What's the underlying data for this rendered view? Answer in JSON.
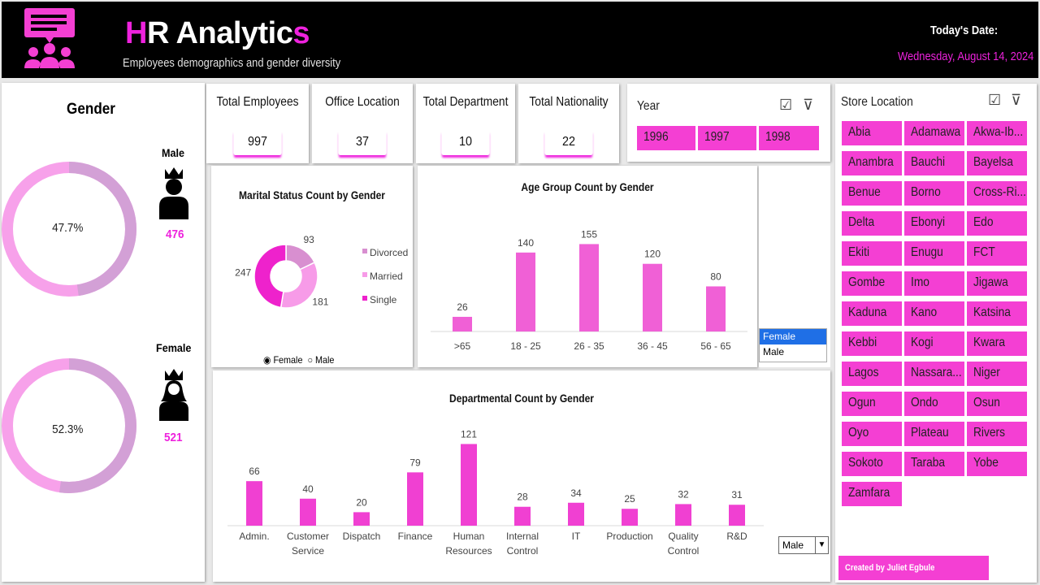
{
  "header": {
    "title_first": "H",
    "title_middle": "R Analytic",
    "title_last": "s",
    "subtitle": "Employees demographics and gender diversity",
    "date_label": "Today's Date:",
    "date_value": "Wednesday, August 14, 2024",
    "logo_icon": "presentation-team-icon"
  },
  "gender": {
    "title": "Gender",
    "male_label": "Male",
    "male_count": "476",
    "male_pct": "47.7%",
    "male_fraction": 0.477,
    "female_label": "Female",
    "female_count": "521",
    "female_pct": "52.3%",
    "female_fraction": 0.523
  },
  "kpis": [
    {
      "title": "Total Employees",
      "value": "997"
    },
    {
      "title": "Office Location",
      "value": "37"
    },
    {
      "title": "Total Department",
      "value": "10"
    },
    {
      "title": "Total Nationality",
      "value": "22"
    }
  ],
  "year_slicer": {
    "title": "Year",
    "items": [
      "1996",
      "1997",
      "1998"
    ]
  },
  "store_slicer": {
    "title": "Store Location",
    "items": [
      "Abia",
      "Adamawa",
      "Akwa-Ib...",
      "Anambra",
      "Bauchi",
      "Bayelsa",
      "Benue",
      "Borno",
      "Cross-Ri...",
      "Delta",
      "Ebonyi",
      "Edo",
      "Ekiti",
      "Enugu",
      "FCT",
      "Gombe",
      "Imo",
      "Jigawa",
      "Kaduna",
      "Kano",
      "Katsina",
      "Kebbi",
      "Kogi",
      "Kwara",
      "Lagos",
      "Nassara...",
      "Niger",
      "Ogun",
      "Ondo",
      "Osun",
      "Oyo",
      "Plateau",
      "Rivers",
      "Sokoto",
      "Taraba",
      "Yobe",
      "Zamfara"
    ]
  },
  "marital": {
    "radio_female": "Female",
    "radio_male": "Male",
    "selected": "Female"
  },
  "gender_select": {
    "options": [
      "Female",
      "Male"
    ],
    "selected": "Female"
  },
  "dept_dropdown": {
    "value": "Male"
  },
  "credit": "Created by Juliet  Egbule",
  "colors": {
    "accent": "#f43fd3",
    "header": "#000000",
    "donut_light": "#f7a1ea",
    "donut_dark": "#d3a0d6"
  },
  "chart_data": [
    {
      "type": "pie",
      "title": "Marital Status Count by Gender",
      "categories": [
        "Divorced",
        "Married",
        "Single"
      ],
      "values": [
        93,
        181,
        247
      ],
      "colors": [
        "#d88fd0",
        "#f79be8",
        "#ee22cc"
      ],
      "legend": "right"
    },
    {
      "type": "bar",
      "title": "Age Group Count by Gender",
      "categories": [
        ">65",
        "18 - 25",
        "26 - 35",
        "36 - 45",
        "56 - 65"
      ],
      "values": [
        26,
        140,
        155,
        120,
        80
      ],
      "color": "#f060d6",
      "ylim": [
        0,
        170
      ],
      "grid": false
    },
    {
      "type": "bar",
      "title": "Departmental Count by Gender",
      "categories": [
        "Admin.",
        "Customer Service",
        "Dispatch",
        "Finance",
        "Human Resources",
        "Internal Control",
        "IT",
        "Production",
        "Quality Control",
        "R&D"
      ],
      "values": [
        66,
        40,
        20,
        79,
        121,
        28,
        34,
        25,
        32,
        31
      ],
      "color": "#f040d2",
      "ylim": [
        0,
        130
      ],
      "grid": false
    }
  ]
}
